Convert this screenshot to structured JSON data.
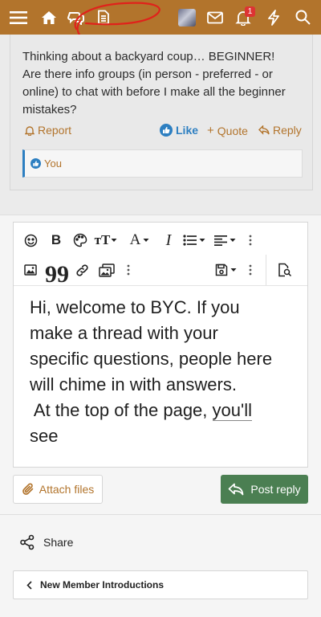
{
  "topbar": {
    "notification_count": "1",
    "icons": [
      "menu-icon",
      "home-icon",
      "chat-bubbles-icon",
      "document-icon",
      "avatar",
      "mail-icon",
      "bell-icon",
      "lightning-icon",
      "search-icon"
    ],
    "background_color": "#b2742c"
  },
  "post": {
    "lines": [
      "Thinking about a backyard coup… BEGINNER!",
      "Are there info groups (in person - preferred - or",
      "online) to chat with before I make all the beginner",
      "mistakes?"
    ],
    "actions": {
      "report": "Report",
      "like": "Like",
      "quote": "Quote",
      "reply": "Reply"
    },
    "reaction_user": "You"
  },
  "editor": {
    "toolbar_icons": [
      "emoji-icon",
      "bold-icon",
      "palette-icon",
      "text-size-icon",
      "font-color-icon",
      "italic-icon",
      "list-icon",
      "align-icon",
      "more-icon",
      "image-icon",
      "quote-icon",
      "link-icon",
      "media-icon",
      "more-icon",
      "save-draft-icon",
      "more-icon",
      "preview-icon"
    ],
    "content_lines": [
      "Hi, welcome to BYC. If you",
      "make a thread with your",
      "specific questions, people here",
      "will chime in with answers.",
      " At the top of the page,",
      "you'll",
      "see"
    ],
    "attach_label": "Attach files",
    "post_reply_label": "Post reply",
    "post_reply_color": "#4b7f52"
  },
  "footer": {
    "share_label": "Share",
    "breadcrumb_label": "New Member Introductions"
  }
}
